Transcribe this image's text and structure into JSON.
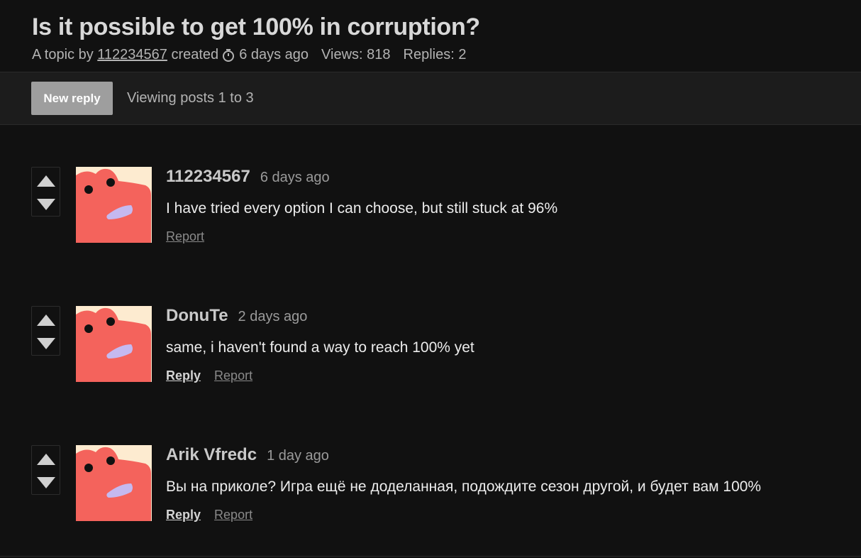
{
  "topic": {
    "title": "Is it possible to get 100% in corruption?",
    "by_prefix": "A topic by",
    "author": "112234567",
    "created_label": "created",
    "created_ago": "6 days ago",
    "views": "Views: 818",
    "replies": "Replies: 2"
  },
  "toolbar": {
    "new_reply_label": "New reply",
    "viewing_text": "Viewing posts 1 to 3"
  },
  "colors": {
    "avatar_body": "#f4635c",
    "avatar_bg": "#fdebd0",
    "avatar_mouth": "#c5b9f0"
  },
  "posts": [
    {
      "author": "112234567",
      "time": "6 days ago",
      "body": "I have tried every option I can choose, but still stuck at 96%",
      "reply_label": "",
      "report_label": "Report"
    },
    {
      "author": "DonuTe",
      "time": "2 days ago",
      "body": "same, i haven't found a way to reach 100% yet",
      "reply_label": "Reply",
      "report_label": "Report"
    },
    {
      "author": "Arik Vfredc",
      "time": "1 day ago",
      "body": "Вы на приколе? Игра ещё не доделанная, подождите сезон другой, и будет вам 100%",
      "reply_label": "Reply",
      "report_label": "Report"
    }
  ]
}
